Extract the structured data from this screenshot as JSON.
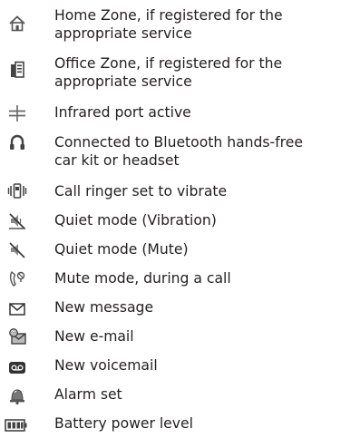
{
  "indicators": [
    {
      "icon": "home-zone-icon",
      "text": "Home Zone, if registered for the\nappropriate service"
    },
    {
      "icon": "office-zone-icon",
      "text": "Office Zone, if registered for the\nappropriate service"
    },
    {
      "icon": "infrared-icon",
      "text": "Infrared port active"
    },
    {
      "icon": "bluetooth-headset-icon",
      "text": "Connected to Bluetooth hands-free\ncar kit or headset"
    },
    {
      "icon": "vibrate-icon",
      "text": "Call ringer set to vibrate"
    },
    {
      "icon": "quiet-vibration-icon",
      "text": "Quiet mode (Vibration)"
    },
    {
      "icon": "quiet-mute-icon",
      "text": "Quiet mode (Mute)"
    },
    {
      "icon": "mute-call-icon",
      "text": "Mute mode, during a call"
    },
    {
      "icon": "new-message-icon",
      "text": "New message"
    },
    {
      "icon": "new-email-icon",
      "text": "New e-mail"
    },
    {
      "icon": "new-voicemail-icon",
      "text": "New voicemail"
    },
    {
      "icon": "alarm-icon",
      "text": "Alarm set"
    },
    {
      "icon": "battery-icon",
      "text": "Battery power level"
    }
  ]
}
